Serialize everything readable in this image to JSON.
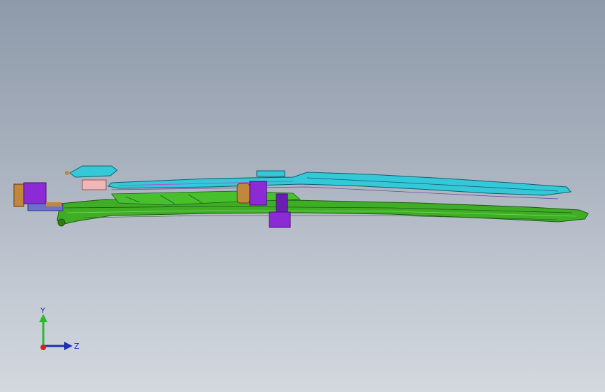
{
  "viewport": {
    "background_top": "#8e9aaa",
    "background_bottom": "#d3d8de"
  },
  "model": {
    "name": "wiper-arm-assembly",
    "colors": {
      "arm_body": "#3fae26",
      "arm_outline": "#1d5a10",
      "blade": "#35c8d8",
      "blade_outline": "#0e5f6e",
      "bracket": "#8c2bd6",
      "clip": "#c2863c",
      "pink_block": "#f2b6b6"
    }
  },
  "triad": {
    "y_label": "Y",
    "z_label": "Z",
    "y_color": "#2fb82f",
    "z_color": "#1d2fb8",
    "origin_color": "#d42020"
  }
}
